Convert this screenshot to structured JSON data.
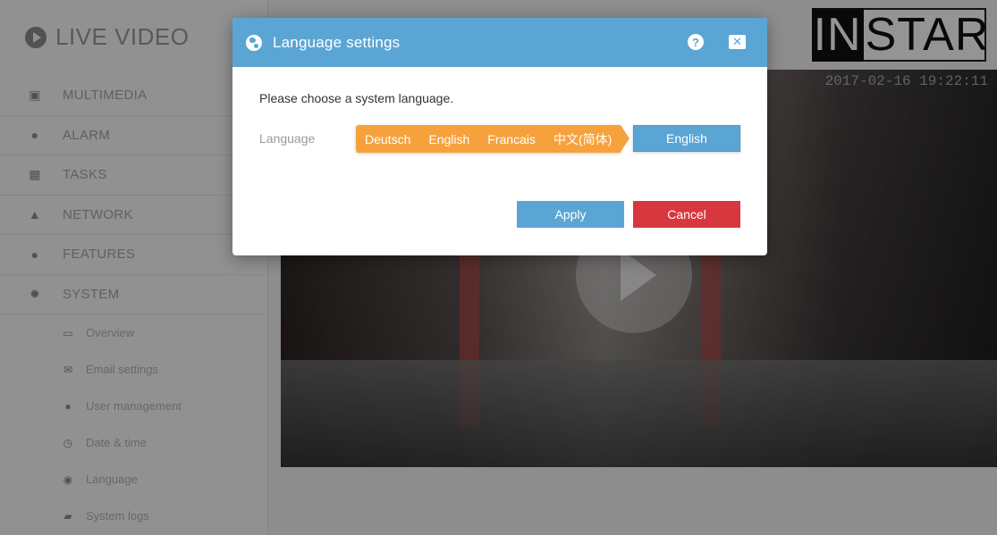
{
  "app": {
    "title": "LIVE VIDEO",
    "logo_dark": "IN",
    "logo_light": "STAR",
    "timestamp": "2017-02-16 19:22:11"
  },
  "sidebar": {
    "items": [
      {
        "label": "MULTIMEDIA",
        "icon": "image-icon"
      },
      {
        "label": "ALARM",
        "icon": "bell-icon"
      },
      {
        "label": "TASKS",
        "icon": "film-icon"
      },
      {
        "label": "NETWORK",
        "icon": "network-icon"
      },
      {
        "label": "FEATURES",
        "icon": "dot-icon"
      },
      {
        "label": "SYSTEM",
        "icon": "gear-icon"
      }
    ],
    "subitems": [
      {
        "label": "Overview",
        "icon": "monitor-icon"
      },
      {
        "label": "Email settings",
        "icon": "envelope-icon"
      },
      {
        "label": "User management",
        "icon": "user-icon"
      },
      {
        "label": "Date & time",
        "icon": "clock-icon"
      },
      {
        "label": "Language",
        "icon": "globe-icon"
      },
      {
        "label": "System logs",
        "icon": "book-icon"
      }
    ]
  },
  "modal": {
    "title": "Language settings",
    "help": "?",
    "close": "✕",
    "prompt": "Please choose a system language.",
    "field_label": "Language",
    "options": [
      "Deutsch",
      "English",
      "Francais",
      "中文(简体)"
    ],
    "selected": "English",
    "apply_label": "Apply",
    "cancel_label": "Cancel"
  },
  "colors": {
    "header": "#5aa5d4",
    "options_bg": "#f7a13d",
    "cancel": "#d9373f"
  }
}
